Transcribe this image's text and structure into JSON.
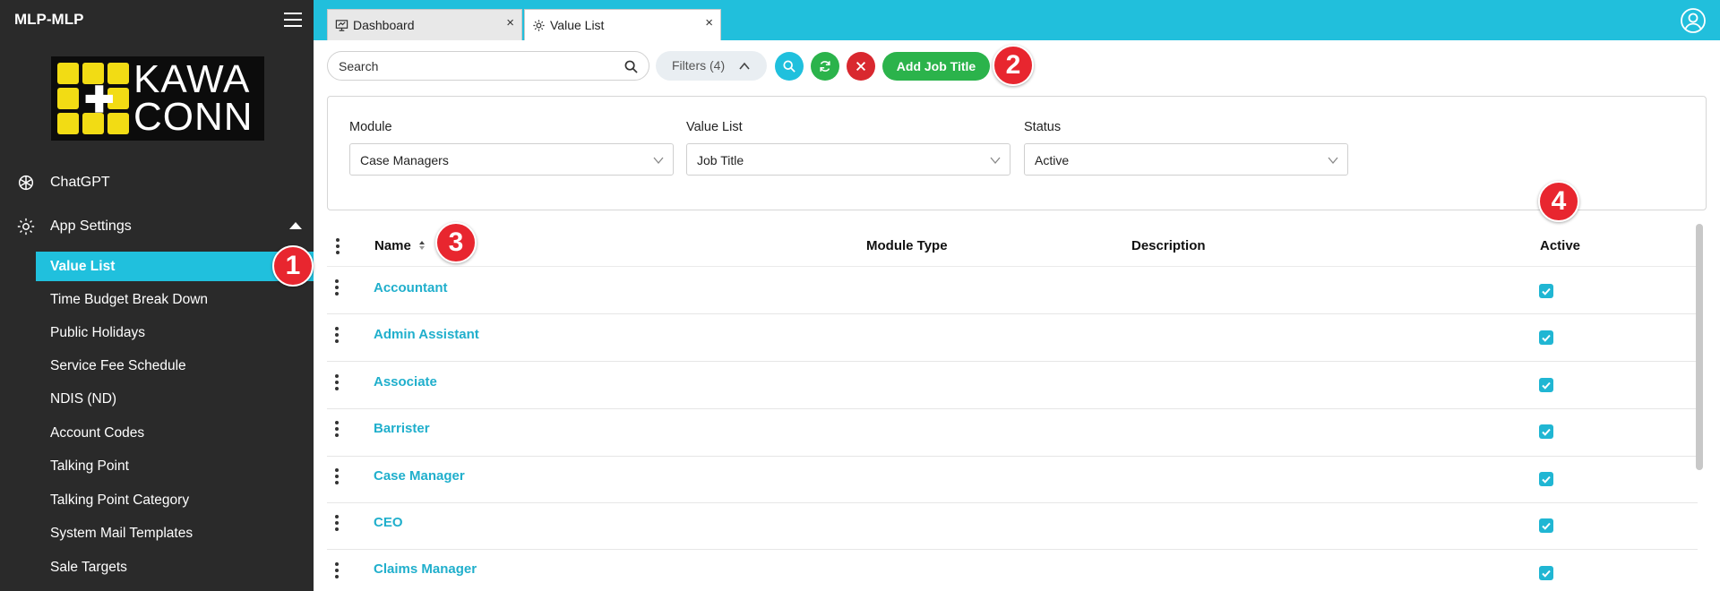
{
  "app": {
    "title": "MLP-MLP"
  },
  "logo": {
    "line1": "KAWA",
    "line2": "CONN"
  },
  "sidebar": {
    "top_items": [
      {
        "label": "ChatGPT",
        "icon": "openai-icon"
      },
      {
        "label": "App Settings",
        "icon": "gear-icon"
      }
    ],
    "sub_items": [
      "Value List",
      "Time Budget Break Down",
      "Public Holidays",
      "Service Fee Schedule",
      "NDIS (ND)",
      "Account Codes",
      "Talking Point",
      "Talking Point Category",
      "System Mail Templates",
      "Sale Targets"
    ],
    "active_item": "Value List"
  },
  "tabs": [
    {
      "label": "Dashboard",
      "icon": "presentation-icon",
      "close": "×"
    },
    {
      "label": "Value List",
      "icon": "gear-icon",
      "close": "×"
    }
  ],
  "toolbar": {
    "search_placeholder": "Search",
    "filters_label": "Filters (4)",
    "add_label": "Add Job Title",
    "colors": {
      "search": "#20c0dd",
      "refresh": "#2bb34b",
      "clear": "#d9282f"
    }
  },
  "filters": [
    {
      "label": "Module",
      "value": "Case Managers"
    },
    {
      "label": "Value List",
      "value": "Job Title"
    },
    {
      "label": "Status",
      "value": "Active"
    }
  ],
  "table": {
    "columns": [
      "Name",
      "Module Type",
      "Description",
      "Active"
    ],
    "rows": [
      {
        "name": "Accountant",
        "module_type": "",
        "description": "",
        "active": true
      },
      {
        "name": "Admin Assistant",
        "module_type": "",
        "description": "",
        "active": true
      },
      {
        "name": "Associate",
        "module_type": "",
        "description": "",
        "active": true
      },
      {
        "name": "Barrister",
        "module_type": "",
        "description": "",
        "active": true
      },
      {
        "name": "Case Manager",
        "module_type": "",
        "description": "",
        "active": true
      },
      {
        "name": "CEO",
        "module_type": "",
        "description": "",
        "active": true
      },
      {
        "name": "Claims Manager",
        "module_type": "",
        "description": "",
        "active": true
      }
    ]
  },
  "annotations": [
    "1",
    "2",
    "3",
    "4"
  ]
}
